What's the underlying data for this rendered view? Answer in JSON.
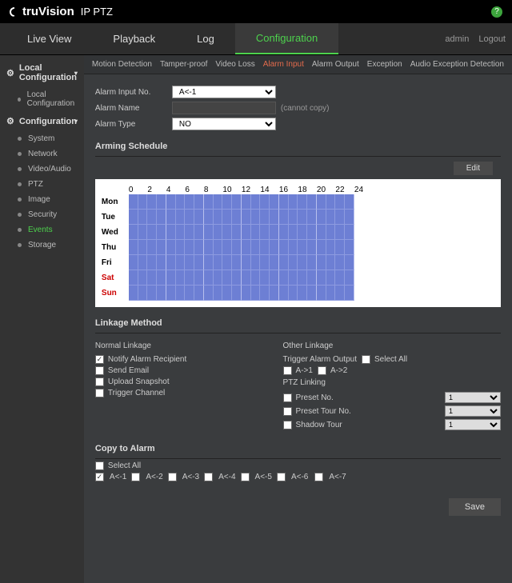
{
  "header": {
    "brand_pre": "tru",
    "brand_bold": "Vision",
    "brand_sub": "IP PTZ"
  },
  "main_tabs": {
    "items": [
      "Live View",
      "Playback",
      "Log",
      "Configuration"
    ],
    "active": 3,
    "user": "admin",
    "logout": "Logout"
  },
  "sidebar": {
    "group1": "Local Configuration",
    "g1_items": [
      "Local Configuration"
    ],
    "group2": "Configuration",
    "g2_items": [
      "System",
      "Network",
      "Video/Audio",
      "PTZ",
      "Image",
      "Security",
      "Events",
      "Storage"
    ],
    "active": "Events"
  },
  "sub_tabs": {
    "items": [
      "Motion Detection",
      "Tamper-proof",
      "Video Loss",
      "Alarm Input",
      "Alarm Output",
      "Exception",
      "Audio Exception Detection"
    ],
    "active": 3
  },
  "form": {
    "input_no_label": "Alarm Input No.",
    "input_no_value": "A<-1",
    "name_label": "Alarm Name",
    "name_value": "",
    "name_note": "(cannot copy)",
    "type_label": "Alarm Type",
    "type_value": "NO"
  },
  "schedule": {
    "title": "Arming Schedule",
    "edit": "Edit",
    "hours": [
      "0",
      "2",
      "4",
      "6",
      "8",
      "10",
      "12",
      "14",
      "16",
      "18",
      "20",
      "22",
      "24"
    ],
    "days": [
      "Mon",
      "Tue",
      "Wed",
      "Thu",
      "Fri",
      "Sat",
      "Sun"
    ]
  },
  "linkage": {
    "title": "Linkage Method",
    "normal_head": "Normal Linkage",
    "other_head": "Other Linkage",
    "notify": "Notify Alarm Recipient",
    "email": "Send Email",
    "upload": "Upload Snapshot",
    "trigger_ch": "Trigger Channel",
    "trigger_out": "Trigger Alarm Output",
    "select_all": "Select All",
    "a1": "A->1",
    "a2": "A->2",
    "ptz_link": "PTZ Linking",
    "preset": "Preset No.",
    "preset_tour": "Preset Tour No.",
    "shadow": "Shadow Tour",
    "sel1": "1",
    "sel2": "1",
    "sel3": "1"
  },
  "copy": {
    "title": "Copy to Alarm",
    "select_all": "Select All",
    "items": [
      "A<-1",
      "A<-2",
      "A<-3",
      "A<-4",
      "A<-5",
      "A<-6",
      "A<-7"
    ]
  },
  "save": "Save"
}
